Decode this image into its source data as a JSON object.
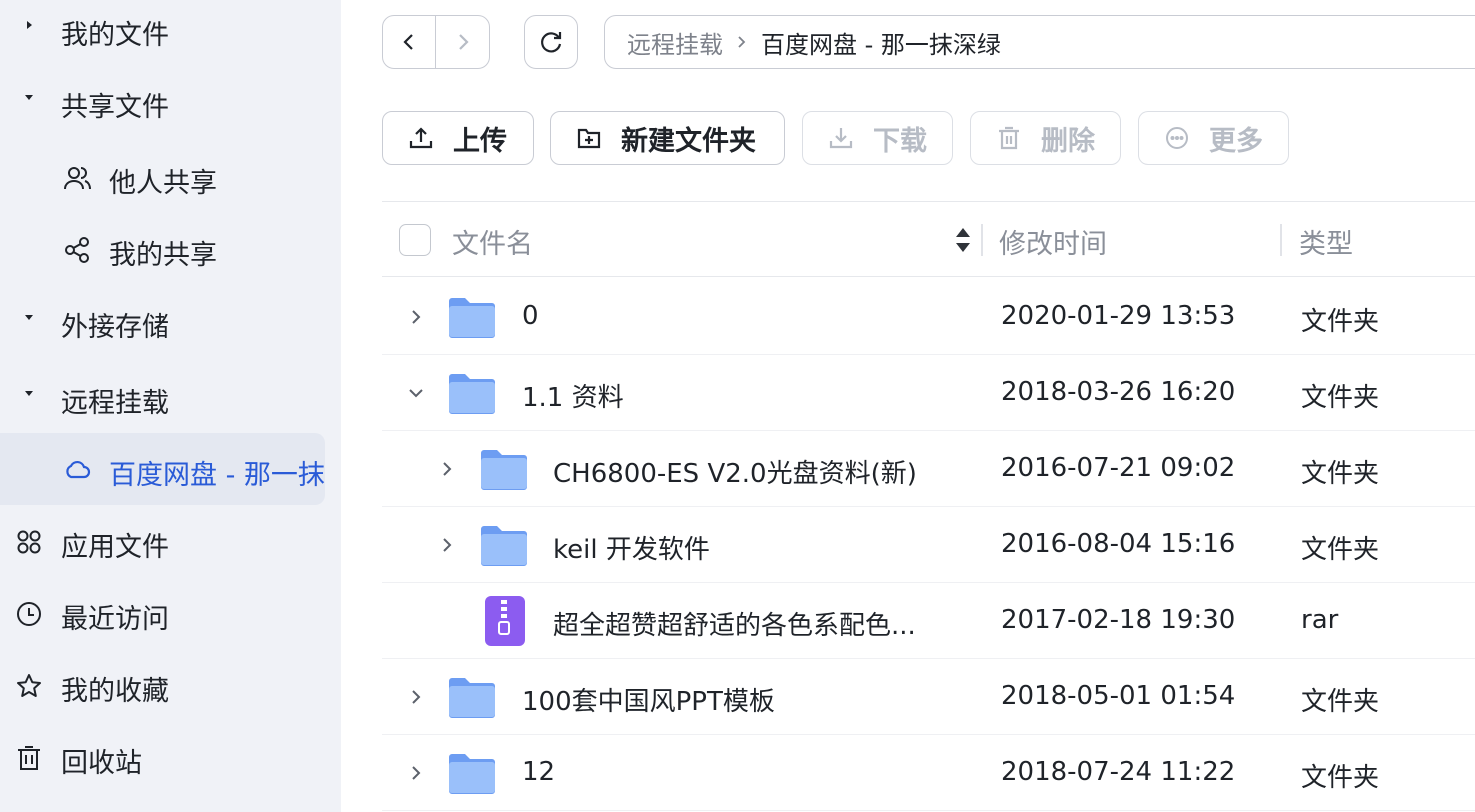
{
  "sidebar": {
    "items": [
      {
        "label": "我的文件"
      },
      {
        "label": "共享文件"
      },
      {
        "label": "他人共享"
      },
      {
        "label": "我的共享"
      },
      {
        "label": "外接存储"
      },
      {
        "label": "远程挂载"
      },
      {
        "label": "百度网盘 - 那一抹"
      },
      {
        "label": "应用文件"
      },
      {
        "label": "最近访问"
      },
      {
        "label": "我的收藏"
      },
      {
        "label": "回收站"
      }
    ]
  },
  "breadcrumb": {
    "parent": "远程挂载",
    "current": "百度网盘 - 那一抹深绿"
  },
  "toolbar": {
    "upload": "上传",
    "new_folder": "新建文件夹",
    "download": "下载",
    "delete": "删除",
    "more": "更多"
  },
  "table": {
    "headers": {
      "name": "文件名",
      "modified": "修改时间",
      "type": "类型"
    },
    "rows": [
      {
        "name": "0",
        "modified": "2020-01-29 13:53",
        "type": "文件夹",
        "icon": "folder-icon",
        "expanded": false
      },
      {
        "name": "1.1 资料",
        "modified": "2018-03-26 16:20",
        "type": "文件夹",
        "icon": "folder-icon",
        "expanded": true
      },
      {
        "name": "CH6800-ES V2.0光盘资料(新)",
        "modified": "2016-07-21 09:02",
        "type": "文件夹",
        "icon": "folder-icon",
        "expanded": false
      },
      {
        "name": "keil 开发软件",
        "modified": "2016-08-04 15:16",
        "type": "文件夹",
        "icon": "folder-icon",
        "expanded": false
      },
      {
        "name": "超全超赞超舒适的各色系配色...",
        "modified": "2017-02-18 19:30",
        "type": "rar",
        "icon": "archive-icon"
      },
      {
        "name": "100套中国风PPT模板",
        "modified": "2018-05-01 01:54",
        "type": "文件夹",
        "icon": "folder-icon",
        "expanded": false
      },
      {
        "name": "12",
        "modified": "2018-07-24 11:22",
        "type": "文件夹",
        "icon": "folder-icon",
        "expanded": false
      }
    ]
  },
  "colors": {
    "sidebar_bg": "#f0f2f7",
    "accent": "#2a5bd7",
    "folder": "#7fa9f5",
    "archive": "#8c5cf0"
  }
}
